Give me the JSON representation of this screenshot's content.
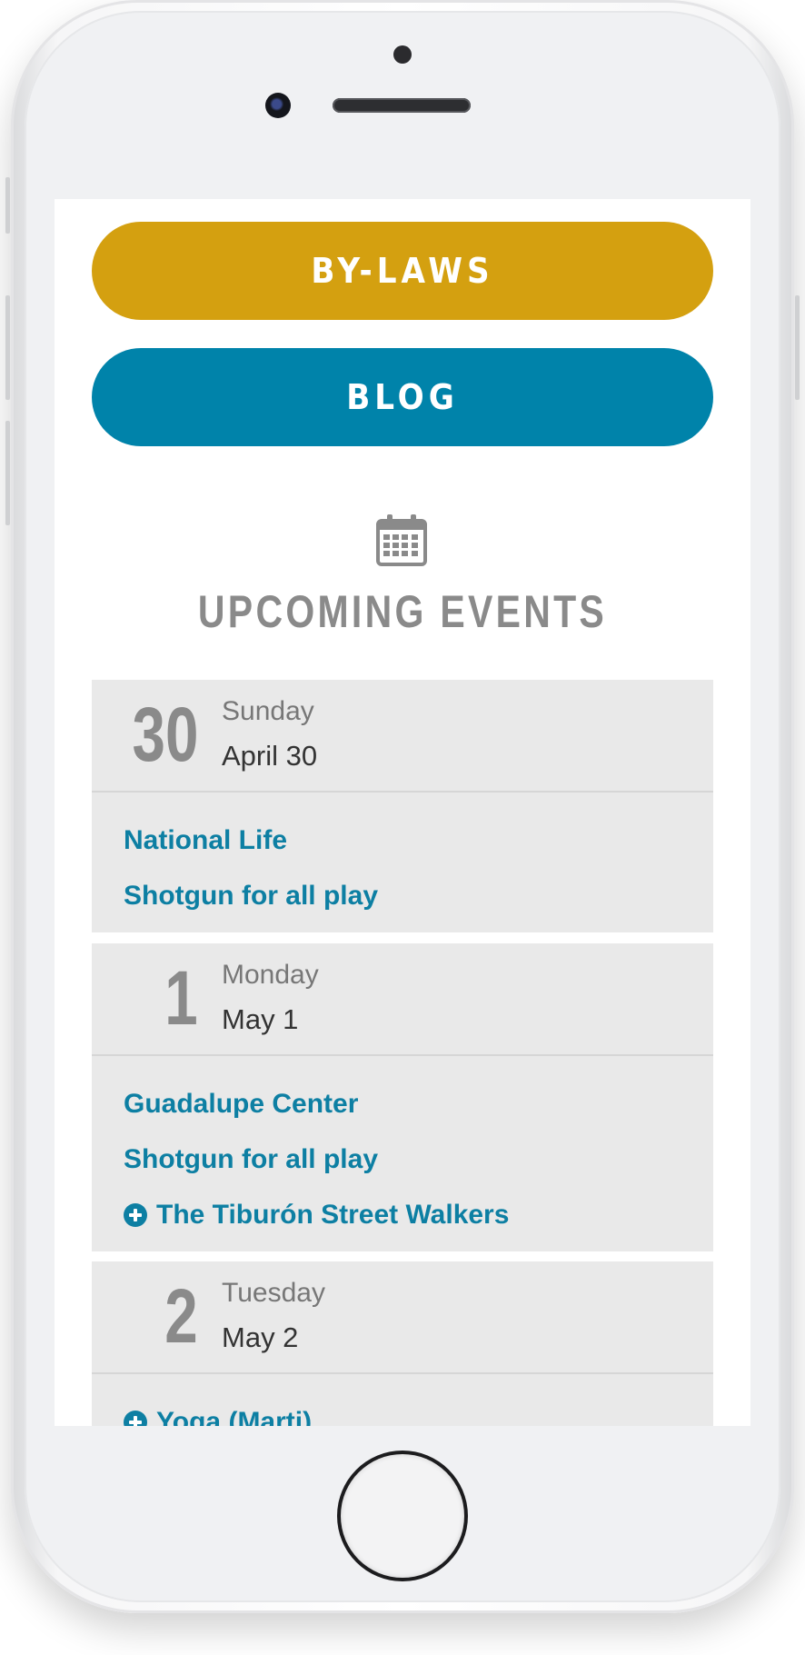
{
  "buttons": {
    "bylaws": "BY-LAWS",
    "blog": "BLOG"
  },
  "events_section": {
    "title": "UPCOMING EVENTS",
    "icon": "calendar-icon"
  },
  "events": [
    {
      "day": "30",
      "weekday": "Sunday",
      "date": "April 30",
      "items": [
        {
          "label": "National Life",
          "icon": null
        },
        {
          "label": "Shotgun for all play",
          "icon": null
        }
      ]
    },
    {
      "day": "1",
      "weekday": "Monday",
      "date": "May 1",
      "items": [
        {
          "label": "Guadalupe Center",
          "icon": null
        },
        {
          "label": "Shotgun for all play",
          "icon": null
        },
        {
          "label": "The Tiburón Street Walkers",
          "icon": "plus-circle-icon"
        }
      ]
    },
    {
      "day": "2",
      "weekday": "Tuesday",
      "date": "May 2",
      "items": [
        {
          "label": "Yoga (Marti)",
          "icon": "plus-circle-icon"
        }
      ]
    }
  ],
  "colors": {
    "bylaws": "#d4a010",
    "blog": "#0083aa",
    "link": "#0d7fa3",
    "muted": "#8a8a8a"
  }
}
